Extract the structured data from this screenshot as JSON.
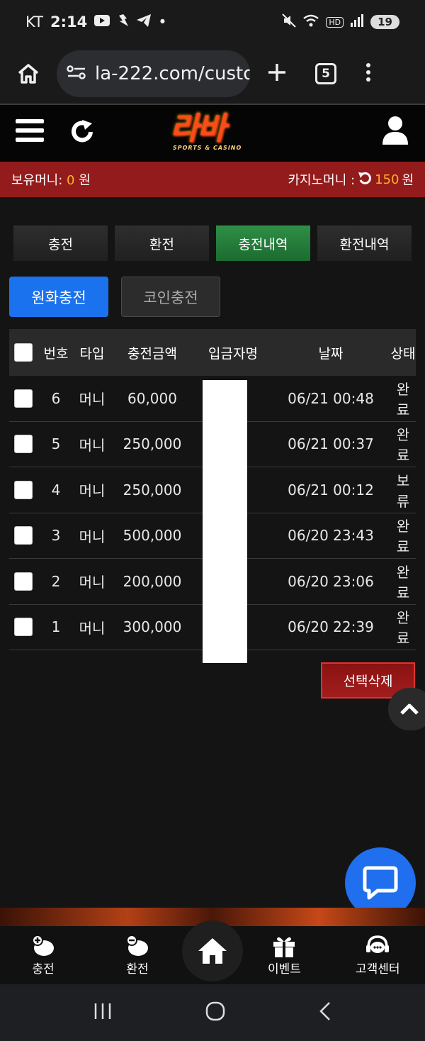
{
  "status_bar": {
    "carrier": "KT",
    "time": "2:14",
    "dot": "•",
    "hd": "HD",
    "battery": "19"
  },
  "browser": {
    "url": "la-222.com/custo",
    "tab_count": "5"
  },
  "money": {
    "holding_label": "보유머니: ",
    "holding_value": "0",
    "holding_unit": " 원",
    "casino_label": "카지노머니 : ",
    "casino_value": "150",
    "casino_unit": " 원"
  },
  "logo": {
    "main": "라바",
    "sub": "SPORTS & CASINO"
  },
  "tabs": [
    "충전",
    "환전",
    "충전내역",
    "환전내역"
  ],
  "subtabs": [
    "원화충전",
    "코인충전"
  ],
  "table": {
    "headers": [
      "번호",
      "타입",
      "충전금액",
      "입금자명",
      "날짜",
      "상태"
    ],
    "rows": [
      {
        "no": "6",
        "type": "머니",
        "amount": "60,000",
        "date": "06/21 00:48",
        "status": "완료"
      },
      {
        "no": "5",
        "type": "머니",
        "amount": "250,000",
        "date": "06/21 00:37",
        "status": "완료"
      },
      {
        "no": "4",
        "type": "머니",
        "amount": "250,000",
        "date": "06/21 00:12",
        "status": "보류"
      },
      {
        "no": "3",
        "type": "머니",
        "amount": "500,000",
        "date": "06/20 23:43",
        "status": "완료"
      },
      {
        "no": "2",
        "type": "머니",
        "amount": "200,000",
        "date": "06/20 23:06",
        "status": "완료"
      },
      {
        "no": "1",
        "type": "머니",
        "amount": "300,000",
        "date": "06/20 22:39",
        "status": "완료"
      }
    ]
  },
  "delete_button": "선택삭제",
  "bottom_nav": [
    "충전",
    "환전",
    "이벤트",
    "고객센터"
  ],
  "colors": {
    "accent_blue": "#1b72ee",
    "active_green": "#1b6b30",
    "money_bar": "#931b1b",
    "amount_orange": "#ffae2a"
  }
}
